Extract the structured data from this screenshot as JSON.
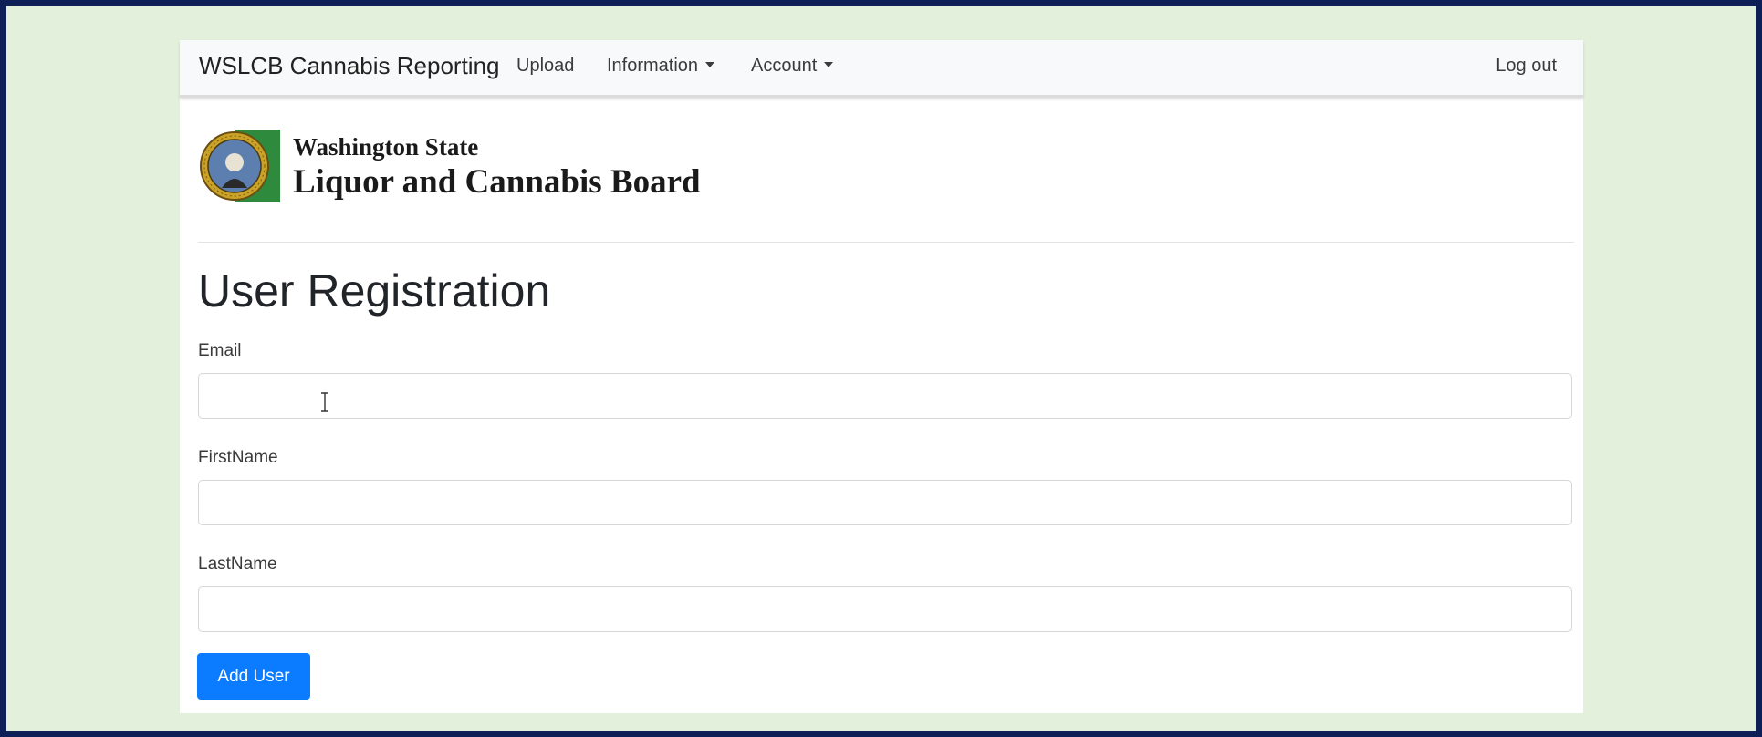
{
  "navbar": {
    "brand": "WSLCB Cannabis Reporting",
    "links": [
      {
        "label": "Upload"
      },
      {
        "label": "Information"
      },
      {
        "label": "Account"
      }
    ],
    "logout": "Log out"
  },
  "header": {
    "org_line1": "Washington State",
    "org_line2": "Liquor and Cannabis Board",
    "seal_icon": "state-seal-icon"
  },
  "main": {
    "title": "User Registration",
    "fields": [
      {
        "label": "Email",
        "value": "",
        "placeholder": ""
      },
      {
        "label": "FirstName",
        "value": "",
        "placeholder": ""
      },
      {
        "label": "LastName",
        "value": "",
        "placeholder": ""
      }
    ],
    "submit_label": "Add User"
  },
  "colors": {
    "outer_border": "#0e1f57",
    "background": "#e3f0db",
    "primary_button": "#0b7bff",
    "seal_green": "#2e8b3e"
  }
}
